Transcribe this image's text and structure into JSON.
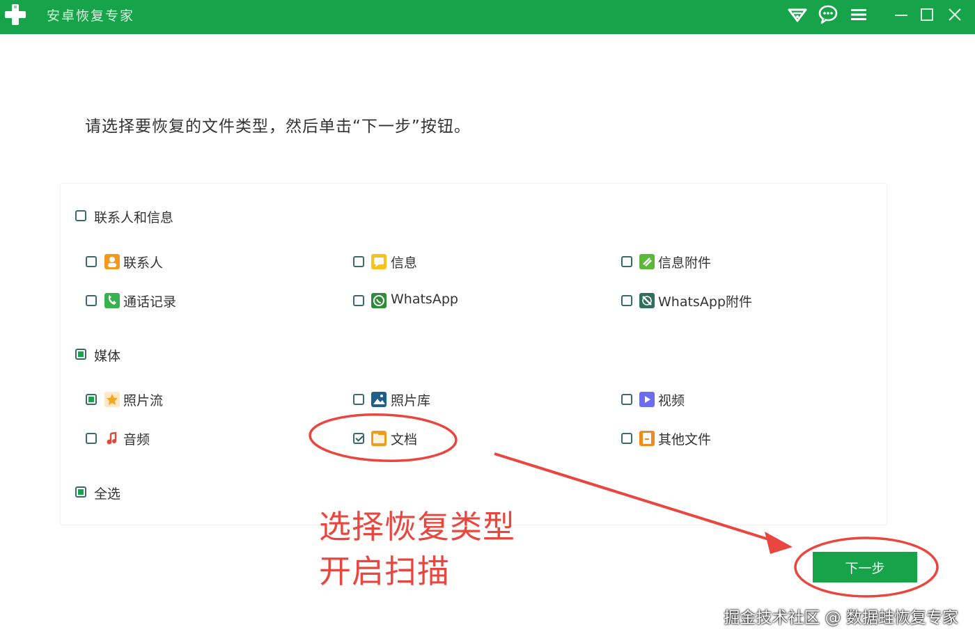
{
  "app": {
    "title": "安卓恢复专家"
  },
  "titlebar": {
    "icons": [
      "wifi-icon",
      "chat-icon",
      "menu-icon",
      "minimize-icon",
      "maximize-icon",
      "close-icon"
    ]
  },
  "instruction": "请选择要恢复的文件类型，然后单击“下一步”按钮。",
  "groups": [
    {
      "label": "联系人和信息",
      "state": "unchecked",
      "items": [
        {
          "label": "联系人",
          "icon": "contacts-icon",
          "color": "#f39a1e",
          "checked": false
        },
        {
          "label": "信息",
          "icon": "messages-icon",
          "color": "#f7c21c",
          "checked": false
        },
        {
          "label": "信息附件",
          "icon": "message-attachment-icon",
          "color": "#5cb83a",
          "checked": false
        },
        {
          "label": "通话记录",
          "icon": "call-log-icon",
          "color": "#37b24d",
          "checked": false
        },
        {
          "label": "WhatsApp",
          "icon": "whatsapp-icon",
          "color": "#2e8b3a",
          "checked": false
        },
        {
          "label": "WhatsApp附件",
          "icon": "whatsapp-attachment-icon",
          "color": "#2f6f5e",
          "checked": false
        }
      ]
    },
    {
      "label": "媒体",
      "state": "partial",
      "items": [
        {
          "label": "照片流",
          "icon": "photo-stream-icon",
          "color": "#f6a623",
          "checked": "partial"
        },
        {
          "label": "照片库",
          "icon": "photo-library-icon",
          "color": "#1f5f8b",
          "checked": false
        },
        {
          "label": "视频",
          "icon": "video-icon",
          "color": "#6b6cf0",
          "checked": false
        },
        {
          "label": "音频",
          "icon": "audio-icon",
          "color": "#e04a3b",
          "checked": false
        },
        {
          "label": "文档",
          "icon": "document-icon",
          "color": "#f29a1b",
          "checked": true
        },
        {
          "label": "其他文件",
          "icon": "other-files-icon",
          "color": "#f08a1d",
          "checked": false
        }
      ]
    }
  ],
  "select_all": {
    "label": "全选",
    "state": "partial"
  },
  "annotations": {
    "line1": "选择恢复类型",
    "line2": "开启扫描"
  },
  "next_button": "下一步",
  "watermark": "掘金技术社区 @ 数据蛙恢复专家",
  "colors": {
    "brand": "#17a34a",
    "annotation": "#e8463f"
  }
}
